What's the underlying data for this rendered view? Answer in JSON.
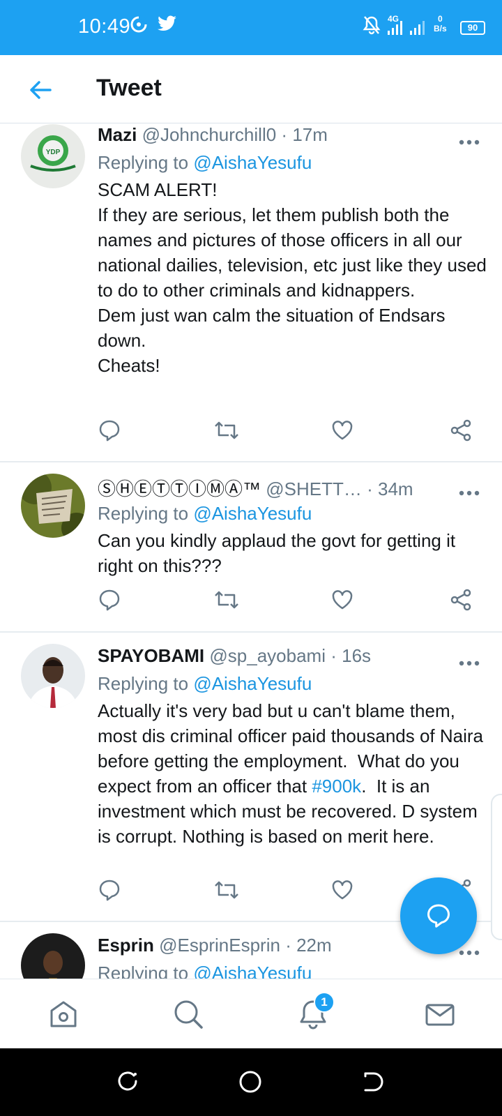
{
  "status_bar": {
    "time": "10:49",
    "network": "4G",
    "speed_value": "0",
    "speed_unit": "B/s",
    "battery": "90",
    "icons": [
      "hotspot-icon",
      "twitter-bird-icon",
      "mute-icon",
      "signal-icon",
      "signal-icon"
    ]
  },
  "header": {
    "title": "Tweet",
    "back_icon": "arrow-left-icon"
  },
  "tweets": [
    {
      "name": "Mazi",
      "handle": "@Johnchurchill0",
      "time": "17m",
      "reply_prefix": "Replying to",
      "reply_to": "@AishaYesufu",
      "body": "SCAM ALERT!\nIf they are serious, let them publish both the names and pictures of those officers in all our national dailies, television, etc just like they used to do to other criminals and kidnappers.\nDem just wan calm the situation of Endsars down.\nCheats!",
      "avatar_text": "YDP"
    },
    {
      "name": "ⓈⒽⒺⓉⓉⒾⓂⒶ™",
      "handle": "@SHETT…",
      "time": "34m",
      "reply_prefix": "Replying to",
      "reply_to": "@AishaYesufu",
      "body": "Can you kindly applaud the govt for getting it right on this???"
    },
    {
      "name": "SPAYOBAMI",
      "handle": "@sp_ayobami",
      "time": "16s",
      "reply_prefix": "Replying to",
      "reply_to": "@AishaYesufu",
      "body_before": "Actually it's very bad but u can't blame them, most dis criminal officer paid thousands of Naira before getting the employment.  What do you expect from an officer that ",
      "hashtag": "#900k",
      "body_after": ".  It is an investment which must be recovered. D system is corrupt. Nothing is based on merit here."
    },
    {
      "name": "Esprin",
      "handle": "@EsprinEsprin",
      "time": "22m",
      "reply_prefix": "Replying to",
      "reply_to": "@AishaYesufu"
    }
  ],
  "actions": [
    "reply-icon",
    "retweet-icon",
    "like-icon",
    "share-icon"
  ],
  "bottom_nav": {
    "items": [
      "home-icon",
      "search-icon",
      "notifications-icon",
      "messages-icon"
    ],
    "notification_count": "1"
  },
  "colors": {
    "brand": "#1da1f2",
    "link": "#1b95e0",
    "secondary_text": "#657786"
  }
}
